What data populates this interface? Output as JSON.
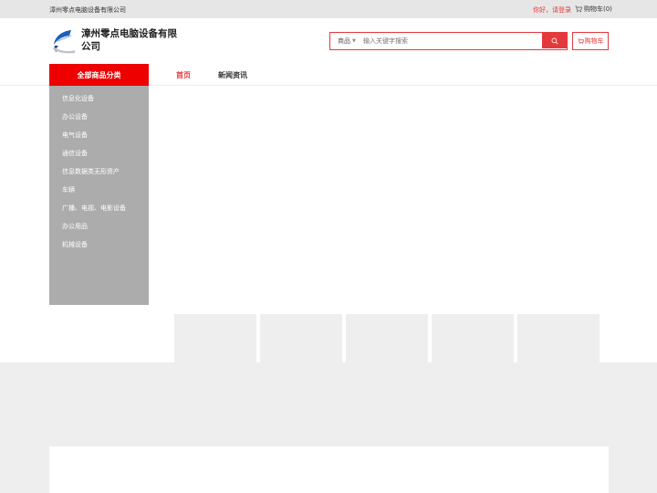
{
  "topbar": {
    "site_name": "漳州零点电脑设备有限公司",
    "greeting": "你好，请登录",
    "cart_mini": "购物车(0)"
  },
  "header": {
    "company_name": "漳州零点电脑设备有限公司"
  },
  "search": {
    "category": "商品",
    "placeholder": "输入关键字搜索"
  },
  "cart_button": {
    "label": "购物车"
  },
  "nav": {
    "all_categories": "全部商品分类",
    "links": [
      "首页",
      "新闻资讯"
    ]
  },
  "sidebar": {
    "items": [
      "信息化设备",
      "办公设备",
      "电气设备",
      "通信设备",
      "信息数据类无形资产",
      "车辆",
      "广播、电视、电影设备",
      "办公用品",
      "机械设备"
    ]
  },
  "colors": {
    "accent": "#e4393c",
    "nav_red": "#ee0000",
    "sidebar_bg": "#acacac",
    "topbar_bg": "#e6e6e6",
    "page_gray": "#eeeeee"
  },
  "icons": {
    "search": "search-icon",
    "cart": "cart-icon",
    "logo": "company-logo"
  }
}
